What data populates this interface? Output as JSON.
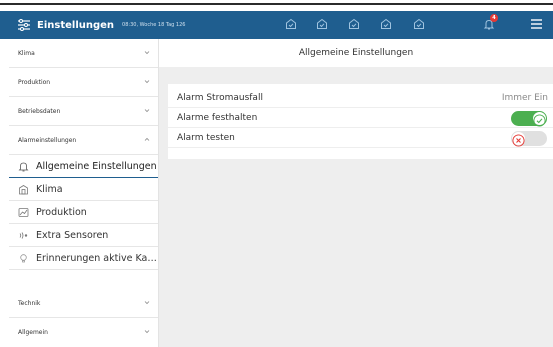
{
  "header": {
    "title": "Einstellungen",
    "subtitle": "08:30, Woche 18 Tag 126",
    "notification_count": "4",
    "accent_color": "#1f5e8f"
  },
  "sidebar": {
    "sections": [
      {
        "label": "Klima",
        "expanded": false
      },
      {
        "label": "Produktion",
        "expanded": false
      },
      {
        "label": "Betriebsdaten",
        "expanded": false
      },
      {
        "label": "Alarmeinstellungen",
        "expanded": true
      },
      {
        "label": "Technik",
        "expanded": false
      },
      {
        "label": "Allgemein",
        "expanded": false
      }
    ],
    "subitems": [
      {
        "label": "Allgemeine Einstellungen",
        "icon": "bell-icon",
        "active": true
      },
      {
        "label": "Klima",
        "icon": "barn-icon",
        "active": false
      },
      {
        "label": "Produktion",
        "icon": "chart-icon",
        "active": false
      },
      {
        "label": "Extra Sensoren",
        "icon": "sensor-icon",
        "active": false
      },
      {
        "label": "Erinnerungen aktive Kalender",
        "icon": "bulb-icon",
        "active": false
      }
    ]
  },
  "main": {
    "title": "Allgemeine Einstellungen",
    "rows": [
      {
        "label": "Alarm Stromausfall",
        "value": "Immer Ein"
      },
      {
        "label": "Alarme festhalten",
        "toggle": true
      },
      {
        "label": "Alarm testen",
        "toggle": false
      }
    ]
  },
  "colors": {
    "toggle_on": "#4caf50",
    "toggle_off": "#e0e0e0",
    "error": "#e53935"
  }
}
